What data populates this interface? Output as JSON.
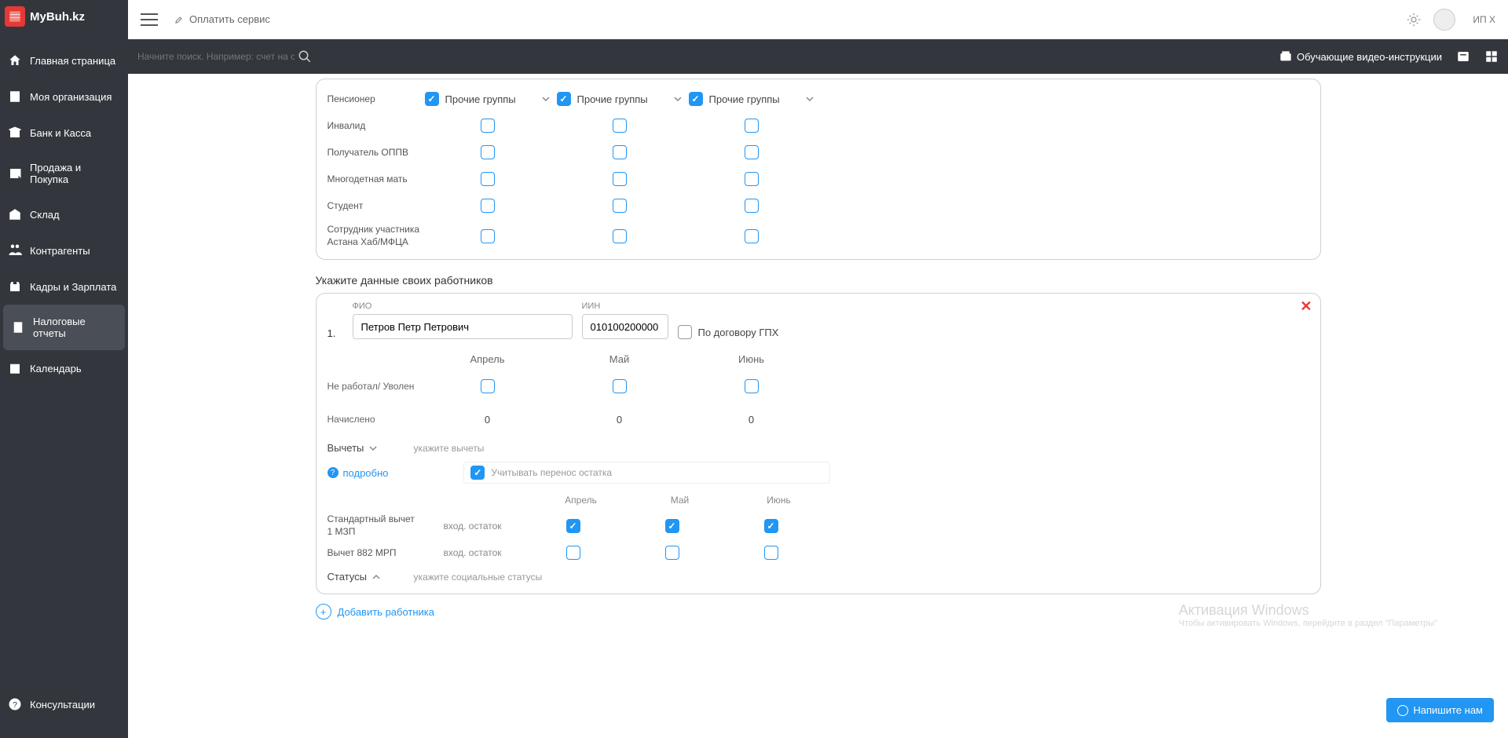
{
  "brand": "MyBuh.kz",
  "topbar": {
    "pay": "Оплатить сервис",
    "user": "ИП X"
  },
  "subbar": {
    "search_placeholder": "Начните поиск. Например: счет на оплату",
    "video": "Обучающие видео-инструкции"
  },
  "sidebar": {
    "items": [
      {
        "label": "Главная страница"
      },
      {
        "label": "Моя организация"
      },
      {
        "label": "Банк и Касса"
      },
      {
        "label": "Продажа и Покупка"
      },
      {
        "label": "Склад"
      },
      {
        "label": "Контрагенты"
      },
      {
        "label": "Кадры и Зарплата"
      },
      {
        "label": "Налоговые отчеты"
      },
      {
        "label": "Календарь"
      }
    ],
    "bottom": {
      "label": "Консультации"
    }
  },
  "status_rows": [
    {
      "label": "Пенсионер",
      "dd": "Прочие группы",
      "checked": true
    },
    {
      "label": "Инвалид"
    },
    {
      "label": "Получатель ОППВ"
    },
    {
      "label": "Многодетная мать"
    },
    {
      "label": "Студент"
    },
    {
      "label": "Сотрудник участника Астана Хаб/МФЦА"
    }
  ],
  "section_title": "Укажите данные своих работников",
  "worker": {
    "num": "1.",
    "fio_label": "ФИО",
    "fio": "Петров Петр Петрович",
    "iin_label": "ИИН",
    "iin": "010100200000",
    "gph": "По договору ГПХ",
    "months": [
      "Апрель",
      "Май",
      "Июнь"
    ],
    "rows": [
      {
        "label": "Не работал/ Уволен",
        "type": "check"
      },
      {
        "label": "Начислено",
        "type": "num",
        "vals": [
          "0",
          "0",
          "0"
        ]
      }
    ],
    "deduct": {
      "label": "Вычеты",
      "hint": "укажите вычеты",
      "detail": "подробно",
      "carry": "Учитывать перенос остатка",
      "months": [
        "Апрель",
        "Май",
        "Июнь"
      ],
      "rows": [
        {
          "label": "Стандартный вычет 1 МЗП",
          "ostat": "вход. остаток",
          "checked": [
            true,
            true,
            true
          ]
        },
        {
          "label": "Вычет 882 МРП",
          "ostat": "вход. остаток",
          "checked": [
            false,
            false,
            false
          ]
        }
      ]
    },
    "status": {
      "label": "Статусы",
      "hint": "укажите социальные статусы"
    }
  },
  "add_worker": "Добавить работника",
  "watermark": {
    "title": "Активация Windows",
    "sub": "Чтобы активировать Windows, перейдите в раздел \"Параметры\""
  },
  "chat": "Напишите нам"
}
